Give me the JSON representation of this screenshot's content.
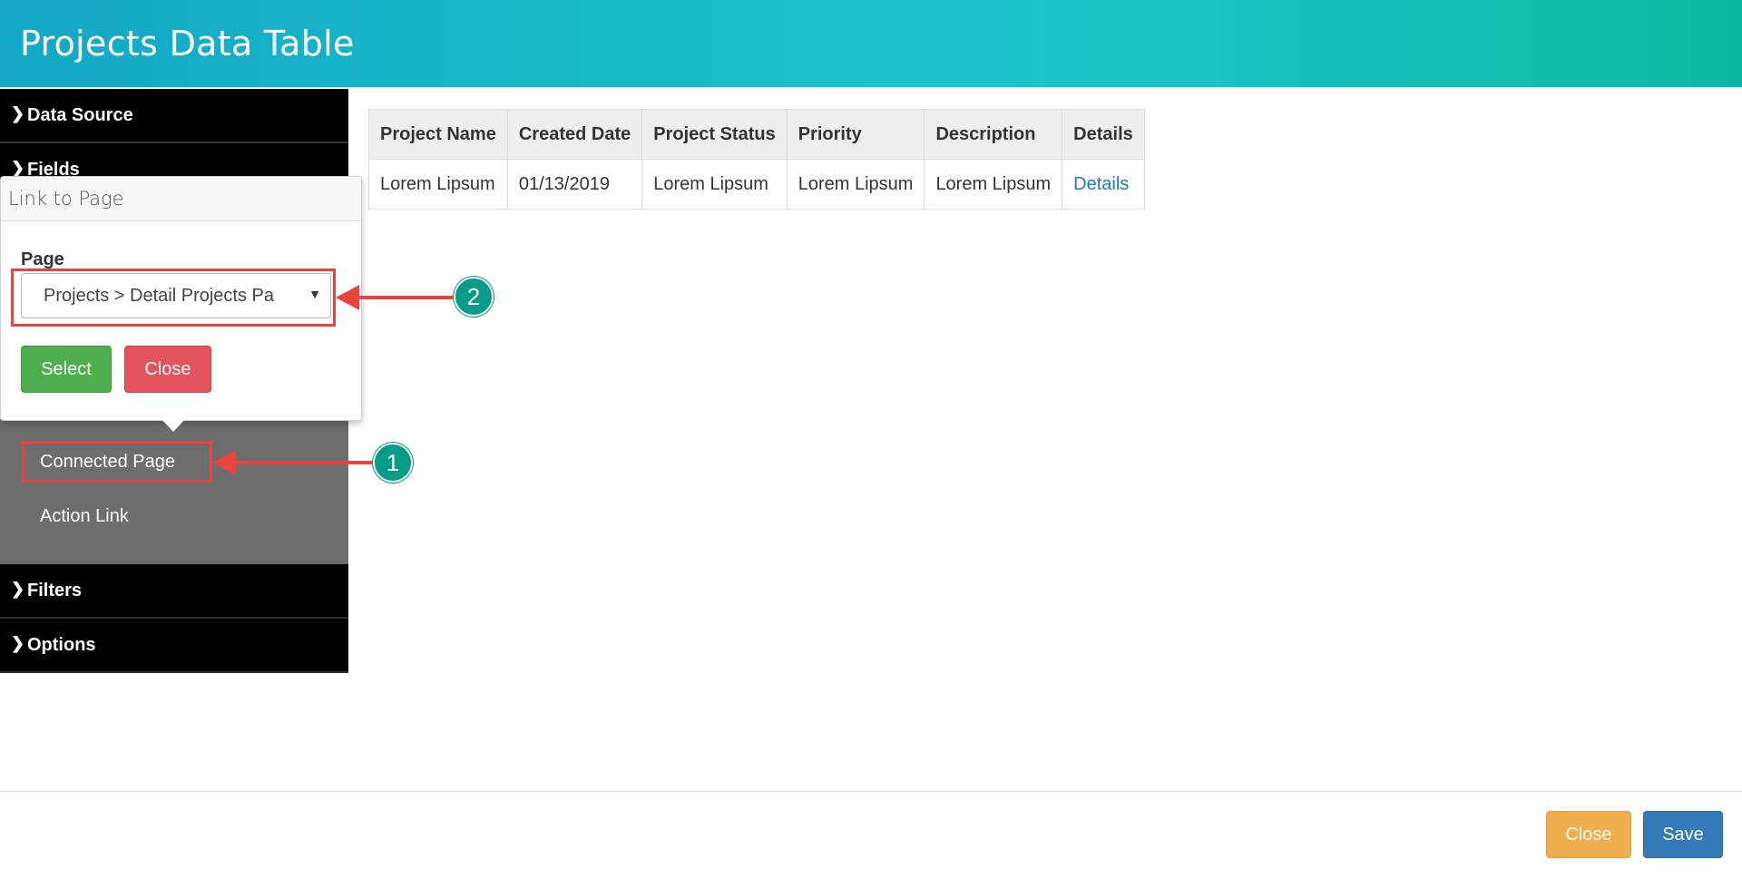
{
  "header": {
    "title": "Projects Data Table"
  },
  "sidebar": {
    "sections": {
      "data_source": "Data Source",
      "fields": "Fields",
      "filters": "Filters",
      "options": "Options"
    },
    "chevron_icon": "chevron-right-icon",
    "link_items": {
      "connected_page": "Connected Page",
      "action_link": "Action Link"
    }
  },
  "popover": {
    "title": "Link to Page",
    "field_label": "Page",
    "selected_page": "Projects > Detail Projects Pa",
    "select_button": "Select",
    "close_button": "Close"
  },
  "table": {
    "columns": [
      "Project Name",
      "Created Date",
      "Project Status",
      "Priority",
      "Description",
      "Details"
    ],
    "rows": [
      [
        "Lorem Lipsum",
        "01/13/2019",
        "Lorem Lipsum",
        "Lorem Lipsum",
        "Lorem Lipsum",
        "Details"
      ]
    ]
  },
  "annotations": {
    "step1": "1",
    "step2": "2"
  },
  "footer": {
    "close_button": "Close",
    "save_button": "Save"
  },
  "colors": {
    "header_start": "#14a8c7",
    "header_end": "#0ab9a3",
    "select_green": "#4cae4c",
    "danger_red": "#e2535e",
    "warning_orange": "#f0ad4e",
    "primary_blue": "#337ab7",
    "annotation_red": "#e8443d",
    "badge_teal": "#0a9a88"
  }
}
